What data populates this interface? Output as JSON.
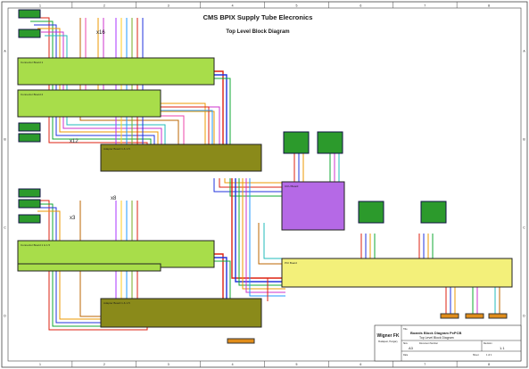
{
  "title": "CMS BPIX Supply Tube Elecronics",
  "subtitle": "Top Level Block Diagram",
  "border": {
    "columns": [
      "1",
      "2",
      "3",
      "4",
      "5",
      "6",
      "7",
      "8"
    ],
    "rows": [
      "A",
      "B",
      "C",
      "D"
    ]
  },
  "multipliers": {
    "top_connectors": "x16",
    "mid_connectors": "x12",
    "low_connectors_a": "x8",
    "low_connectors_b": "x3"
  },
  "blocks": {
    "connector_board_1": "Connector Board 1",
    "connector_board_2": "Connector Board 2",
    "connector_board_3": "Connector Board 1 & 1.5",
    "connector_board_4": "Connector Board 1 & 1.5",
    "adapter_board_1": "Adapter Board 1 & 1.5",
    "adapter_board_2": "Adapter Board 1 & 1.5",
    "ccu_board": "CCU Board",
    "pci_board": "PCI Board"
  },
  "title_block": {
    "company": "Wigner FK",
    "company_sub": "Budapest, Hungary",
    "title_label": "Title",
    "title_value": "Boards Block Diagram PxPCB",
    "title_value2": "Top Level Block Diagram",
    "size_label": "Size",
    "size_value": "A3",
    "doc_label": "Document Number",
    "rev_label": "Revision",
    "rev_value": "1.1",
    "date_label": "Date",
    "sheet_label": "Sheet",
    "sheet_value": "1 of 1"
  }
}
